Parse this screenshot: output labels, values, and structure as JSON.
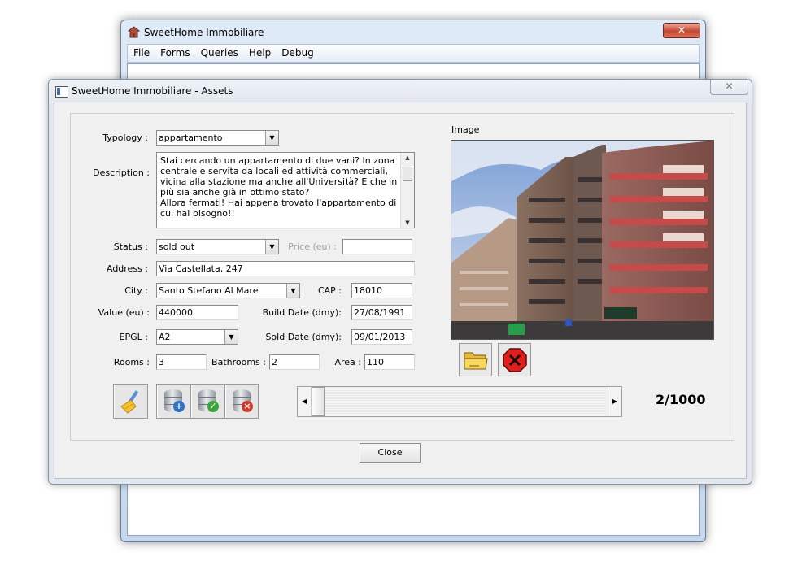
{
  "main_window": {
    "title": "SweetHome Immobiliare",
    "close_glyph": "✕",
    "menu": [
      "File",
      "Forms",
      "Queries",
      "Help",
      "Debug"
    ]
  },
  "dialog": {
    "title": "SweetHome Immobiliare - Assets",
    "close_glyph": "✕"
  },
  "form": {
    "typology": {
      "label": "Typology :",
      "value": "appartamento"
    },
    "description": {
      "label": "Description :",
      "value": "Stai cercando un appartamento di due vani? In zona centrale e servita da locali ed attività commerciali, vicina alla stazione ma anche all'Università? E che in più sia anche già in ottimo stato?\nAllora fermati! Hai appena trovato l'appartamento di cui hai bisogno!!"
    },
    "status": {
      "label": "Status :",
      "value": "sold out"
    },
    "price": {
      "label": "Price (eu) :",
      "value": ""
    },
    "address": {
      "label": "Address :",
      "value": "Via Castellata, 247"
    },
    "city": {
      "label": "City :",
      "value": "Santo Stefano Al Mare"
    },
    "cap": {
      "label": "CAP :",
      "value": "18010"
    },
    "value_eu": {
      "label": "Value (eu) :",
      "value": "440000"
    },
    "build_date": {
      "label": "Build Date (dmy):",
      "value": "27/08/1991"
    },
    "epgl": {
      "label": "EPGL  :",
      "value": "A2"
    },
    "sold_date": {
      "label": "Sold Date (dmy):",
      "value": "09/01/2013"
    },
    "rooms": {
      "label": "Rooms :",
      "value": "3"
    },
    "bathrooms": {
      "label": "Bathrooms :",
      "value": "2"
    },
    "area": {
      "label": "Area :",
      "value": "110"
    }
  },
  "image_section": {
    "label": "Image"
  },
  "navigator": {
    "counter": "2/1000",
    "position_fraction": 0.002
  },
  "buttons": {
    "close": "Close"
  },
  "icons": {
    "app": "house-icon",
    "clear": "broom-icon",
    "db_add": "database-add-icon",
    "db_save": "database-check-icon",
    "db_delete": "database-delete-icon",
    "open_image": "folder-icon",
    "remove_image": "red-x-icon"
  },
  "colors": {
    "accent": "#c7462f",
    "title_bar": "#dfeaf7"
  }
}
